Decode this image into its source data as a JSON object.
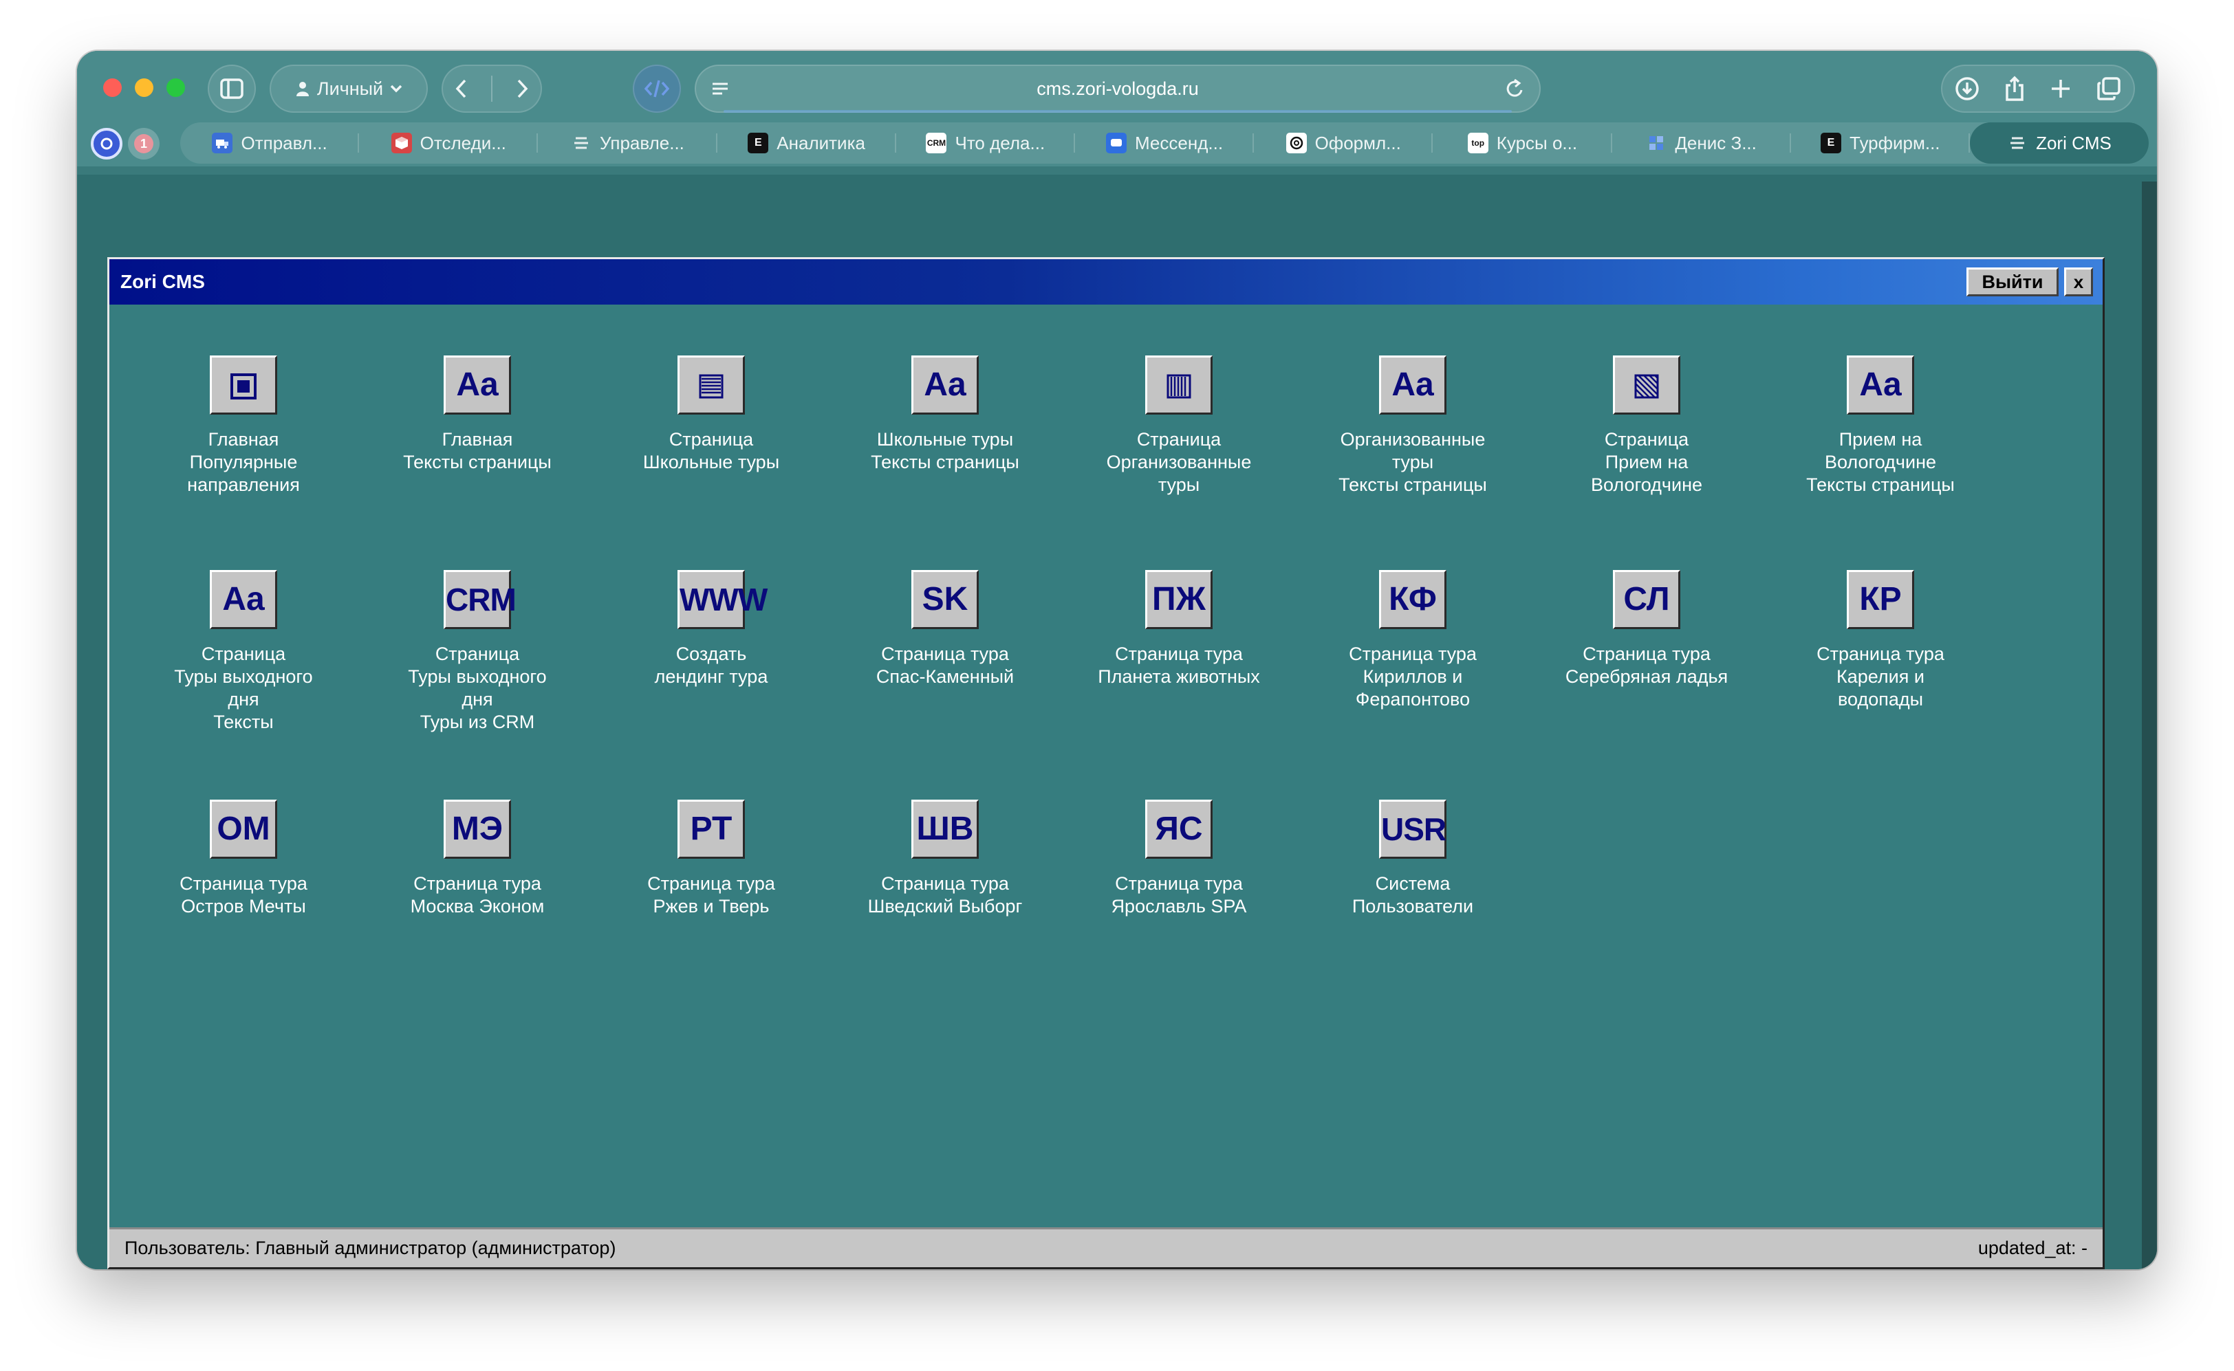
{
  "browser": {
    "profile_label": "Личный",
    "url": "cms.zori-vologda.ru",
    "tab_badge_count": "1",
    "tabs": [
      {
        "label": "Отправл...",
        "icon": "delivery-icon"
      },
      {
        "label": "Отследи...",
        "icon": "box-icon"
      },
      {
        "label": "Управле...",
        "icon": "stack-icon"
      },
      {
        "label": "Аналитика",
        "icon": "e-icon",
        "icon_text": "E"
      },
      {
        "label": "Что дела...",
        "icon": "crm-icon",
        "icon_text": "CRM"
      },
      {
        "label": "Мессенд...",
        "icon": "chat-icon"
      },
      {
        "label": "Оформл...",
        "icon": "openai-icon"
      },
      {
        "label": "Курсы о...",
        "icon": "top-icon",
        "icon_text": "top"
      },
      {
        "label": "Денис З...",
        "icon": "grid-icon"
      },
      {
        "label": "Турфирм...",
        "icon": "e-icon",
        "icon_text": "E"
      },
      {
        "label": "Zori CMS",
        "icon": "stack-icon",
        "active": true
      }
    ]
  },
  "cms": {
    "title": "Zori CMS",
    "logout_label": "Выйти",
    "close_label": "x",
    "items": [
      {
        "tile_type": "icon",
        "icon": "square-filled-icon",
        "lines": [
          "Главная",
          "Популярные",
          "направления"
        ]
      },
      {
        "tile_type": "text",
        "tile_text": "Aa",
        "lines": [
          "Главная",
          "Тексты страницы"
        ]
      },
      {
        "tile_type": "icon",
        "icon": "horizontal-lines-icon",
        "lines": [
          "Страница",
          "Школьные туры"
        ]
      },
      {
        "tile_type": "text",
        "tile_text": "Aa",
        "lines": [
          "Школьные туры",
          "Тексты страницы"
        ]
      },
      {
        "tile_type": "icon",
        "icon": "vertical-lines-icon",
        "lines": [
          "Страница",
          "Организованные",
          "туры"
        ]
      },
      {
        "tile_type": "text",
        "tile_text": "Aa",
        "lines": [
          "Организованные",
          "туры",
          "Тексты страницы"
        ]
      },
      {
        "tile_type": "icon",
        "icon": "diagonal-lines-icon",
        "lines": [
          "Страница",
          "Прием на",
          "Вологодчине"
        ]
      },
      {
        "tile_type": "text",
        "tile_text": "Aa",
        "lines": [
          "Прием на",
          "Вологодчине",
          "Тексты страницы"
        ]
      },
      {
        "tile_type": "text",
        "tile_text": "Aa",
        "lines": [
          "Страница",
          "Туры выходного",
          "дня",
          "Тексты"
        ]
      },
      {
        "tile_type": "text",
        "tile_text": "CRM",
        "small": true,
        "lines": [
          "Страница",
          "Туры выходного",
          "дня",
          "Туры из CRM"
        ]
      },
      {
        "tile_type": "text",
        "tile_text": "WWW",
        "small": true,
        "lines": [
          "Создать",
          "лендинг тура"
        ]
      },
      {
        "tile_type": "text",
        "tile_text": "SK",
        "lines": [
          "Страница тура",
          "Спас-Каменный"
        ]
      },
      {
        "tile_type": "text",
        "tile_text": "ПЖ",
        "lines": [
          "Страница тура",
          "Планета животных"
        ]
      },
      {
        "tile_type": "text",
        "tile_text": "КФ",
        "lines": [
          "Страница тура",
          "Кириллов и",
          "Ферапонтово"
        ]
      },
      {
        "tile_type": "text",
        "tile_text": "СЛ",
        "lines": [
          "Страница тура",
          "Серебряная ладья"
        ]
      },
      {
        "tile_type": "text",
        "tile_text": "КР",
        "lines": [
          "Страница тура",
          "Карелия и",
          "водопады"
        ]
      },
      {
        "tile_type": "text",
        "tile_text": "ОМ",
        "lines": [
          "Страница тура",
          "Остров Мечты"
        ]
      },
      {
        "tile_type": "text",
        "tile_text": "МЭ",
        "lines": [
          "Страница тура",
          "Москва Эконом"
        ]
      },
      {
        "tile_type": "text",
        "tile_text": "РТ",
        "lines": [
          "Страница тура",
          "Ржев и Тверь"
        ]
      },
      {
        "tile_type": "text",
        "tile_text": "ШВ",
        "lines": [
          "Страница тура",
          "Шведский Выборг"
        ]
      },
      {
        "tile_type": "text",
        "tile_text": "ЯС",
        "lines": [
          "Страница тура",
          "Ярославль SPA"
        ]
      },
      {
        "tile_type": "text",
        "tile_text": "USR",
        "small": true,
        "lines": [
          "Система",
          "Пользователи"
        ]
      }
    ],
    "status": {
      "user_text": "Пользователь: Главный администратор (администратор)",
      "updated_text": "updated_at: -"
    }
  },
  "colors": {
    "cms_background": "#367d7f",
    "titlebar_start": "#00108a",
    "titlebar_end": "#3c80dc",
    "tile_text": "#0a0a7a"
  }
}
